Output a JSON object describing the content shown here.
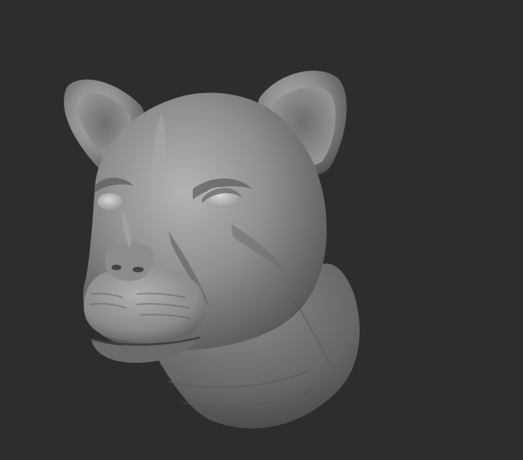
{
  "viewport": {
    "background_color": "#2d2d2d",
    "model": {
      "subject": "lioness-head-sculpt",
      "material_color": "#8a8a8a"
    }
  }
}
